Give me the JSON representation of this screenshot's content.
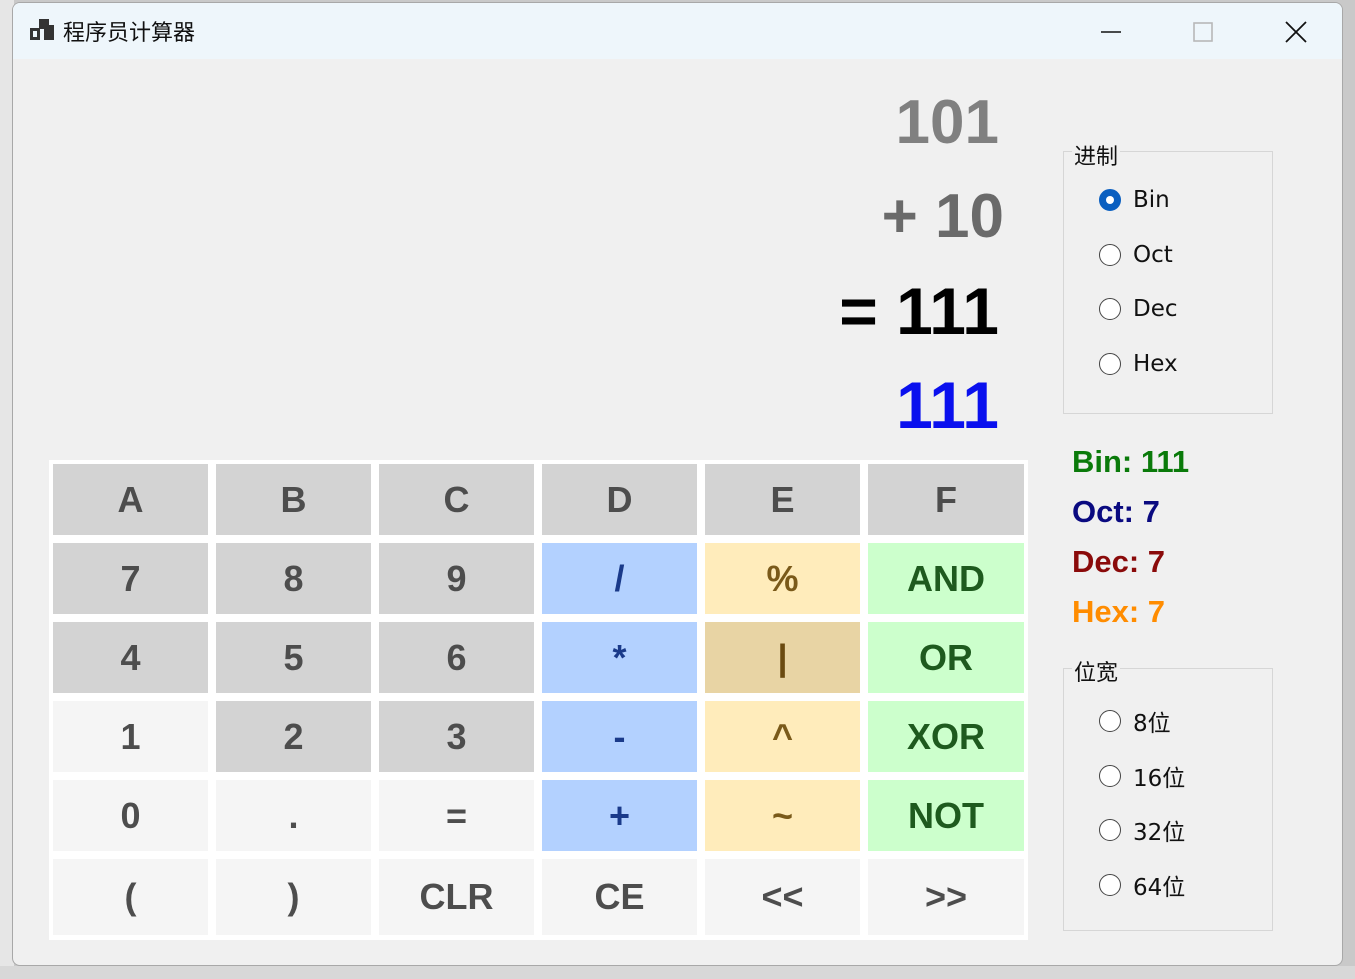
{
  "window": {
    "title": "程序员计算器"
  },
  "display": {
    "operand1": "101",
    "operator_line": "+ 10",
    "result_line": "= 111",
    "current": "111"
  },
  "keypad": {
    "rows": [
      [
        {
          "label": "A",
          "style": "gray"
        },
        {
          "label": "B",
          "style": "gray"
        },
        {
          "label": "C",
          "style": "gray"
        },
        {
          "label": "D",
          "style": "gray"
        },
        {
          "label": "E",
          "style": "gray"
        },
        {
          "label": "F",
          "style": "gray"
        }
      ],
      [
        {
          "label": "7",
          "style": "gray"
        },
        {
          "label": "8",
          "style": "gray"
        },
        {
          "label": "9",
          "style": "gray"
        },
        {
          "label": "/",
          "style": "blue"
        },
        {
          "label": "%",
          "style": "yellow"
        },
        {
          "label": "AND",
          "style": "green"
        }
      ],
      [
        {
          "label": "4",
          "style": "gray"
        },
        {
          "label": "5",
          "style": "gray"
        },
        {
          "label": "6",
          "style": "gray"
        },
        {
          "label": "*",
          "style": "blue"
        },
        {
          "label": "|",
          "style": "tan"
        },
        {
          "label": "OR",
          "style": "green"
        }
      ],
      [
        {
          "label": "1",
          "style": "light"
        },
        {
          "label": "2",
          "style": "gray"
        },
        {
          "label": "3",
          "style": "gray"
        },
        {
          "label": "-",
          "style": "blue"
        },
        {
          "label": "^",
          "style": "yellow"
        },
        {
          "label": "XOR",
          "style": "green"
        }
      ],
      [
        {
          "label": "0",
          "style": "light"
        },
        {
          "label": ".",
          "style": "light"
        },
        {
          "label": "=",
          "style": "light"
        },
        {
          "label": "+",
          "style": "blue"
        },
        {
          "label": "~",
          "style": "yellow"
        },
        {
          "label": "NOT",
          "style": "green"
        }
      ],
      [
        {
          "label": "(",
          "style": "light"
        },
        {
          "label": ")",
          "style": "light"
        },
        {
          "label": "CLR",
          "style": "light"
        },
        {
          "label": "CE",
          "style": "light"
        },
        {
          "label": "<<",
          "style": "light"
        },
        {
          "label": ">>",
          "style": "light"
        }
      ]
    ]
  },
  "radix": {
    "title": "进制",
    "options": [
      {
        "label": "Bin",
        "checked": true
      },
      {
        "label": "Oct",
        "checked": false
      },
      {
        "label": "Dec",
        "checked": false
      },
      {
        "label": "Hex",
        "checked": false
      }
    ]
  },
  "conversions": [
    {
      "label": "Bin: 111",
      "color": "#0a7a0a"
    },
    {
      "label": "Oct: 7",
      "color": "#0a0a80"
    },
    {
      "label": "Dec: 7",
      "color": "#8a0a0a"
    },
    {
      "label": "Hex: 7",
      "color": "#ff8c00"
    }
  ],
  "bitwidth": {
    "title": "位宽",
    "options": [
      {
        "label": "8位",
        "checked": false
      },
      {
        "label": "16位",
        "checked": false
      },
      {
        "label": "32位",
        "checked": false
      },
      {
        "label": "64位",
        "checked": false
      }
    ]
  }
}
